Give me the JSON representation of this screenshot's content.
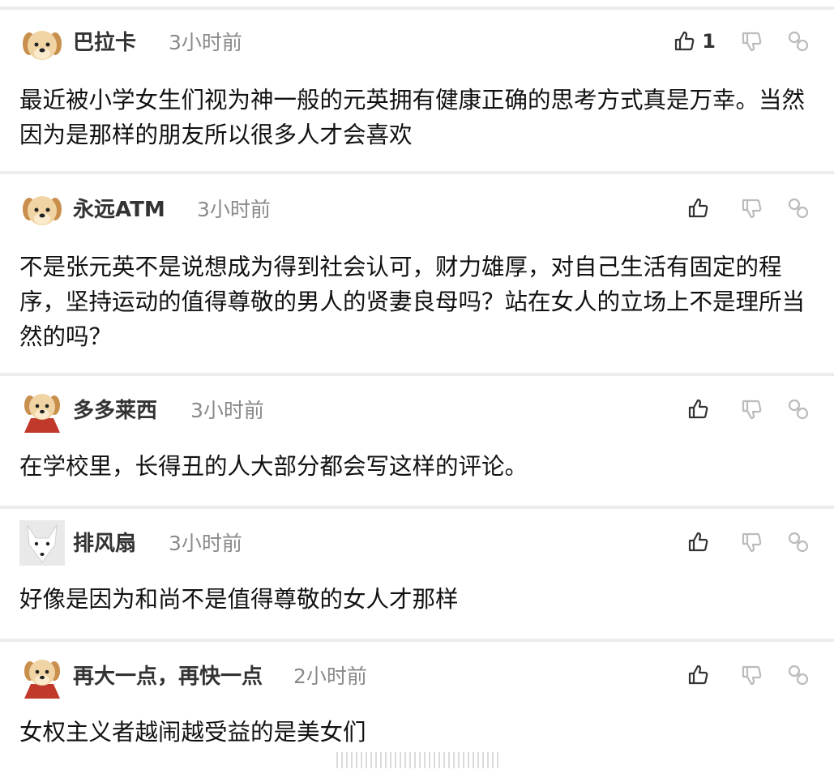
{
  "comments": [
    {
      "username": "巴拉卡",
      "time": "3小时前",
      "like_count": "1",
      "text": "最近被小学女生们视为神一般的元英拥有健康正确的思考方式真是万幸。当然因为是那样的朋友所以很多人才会喜欢",
      "avatar": "puppy-icon"
    },
    {
      "username": "永远ATM",
      "time": "3小时前",
      "like_count": "",
      "text": "不是张元英不是说想成为得到社会认可，财力雄厚，对自己生活有固定的程序，坚持运动的值得尊敬的男人的贤妻良母吗？站在女人的立场上不是理所当然的吗？",
      "avatar": "puppy-icon"
    },
    {
      "username": "多多莱西",
      "time": "3小时前",
      "like_count": "",
      "text": "在学校里，长得丑的人大部分都会写这样的评论。",
      "avatar": "puppy-with-cape-icon"
    },
    {
      "username": "排风扇",
      "time": "3小时前",
      "like_count": "",
      "text": "好像是因为和尚不是值得尊敬的女人才那样",
      "avatar": "white-fox-icon"
    },
    {
      "username": "再大一点，再快一点",
      "time": "2小时前",
      "like_count": "",
      "text": "女权主义者越闹越受益的是美女们",
      "avatar": "puppy-with-cape-icon"
    }
  ],
  "colors": {
    "separator": "#ececec",
    "time": "#8a8a8a",
    "icon": "#333333"
  }
}
